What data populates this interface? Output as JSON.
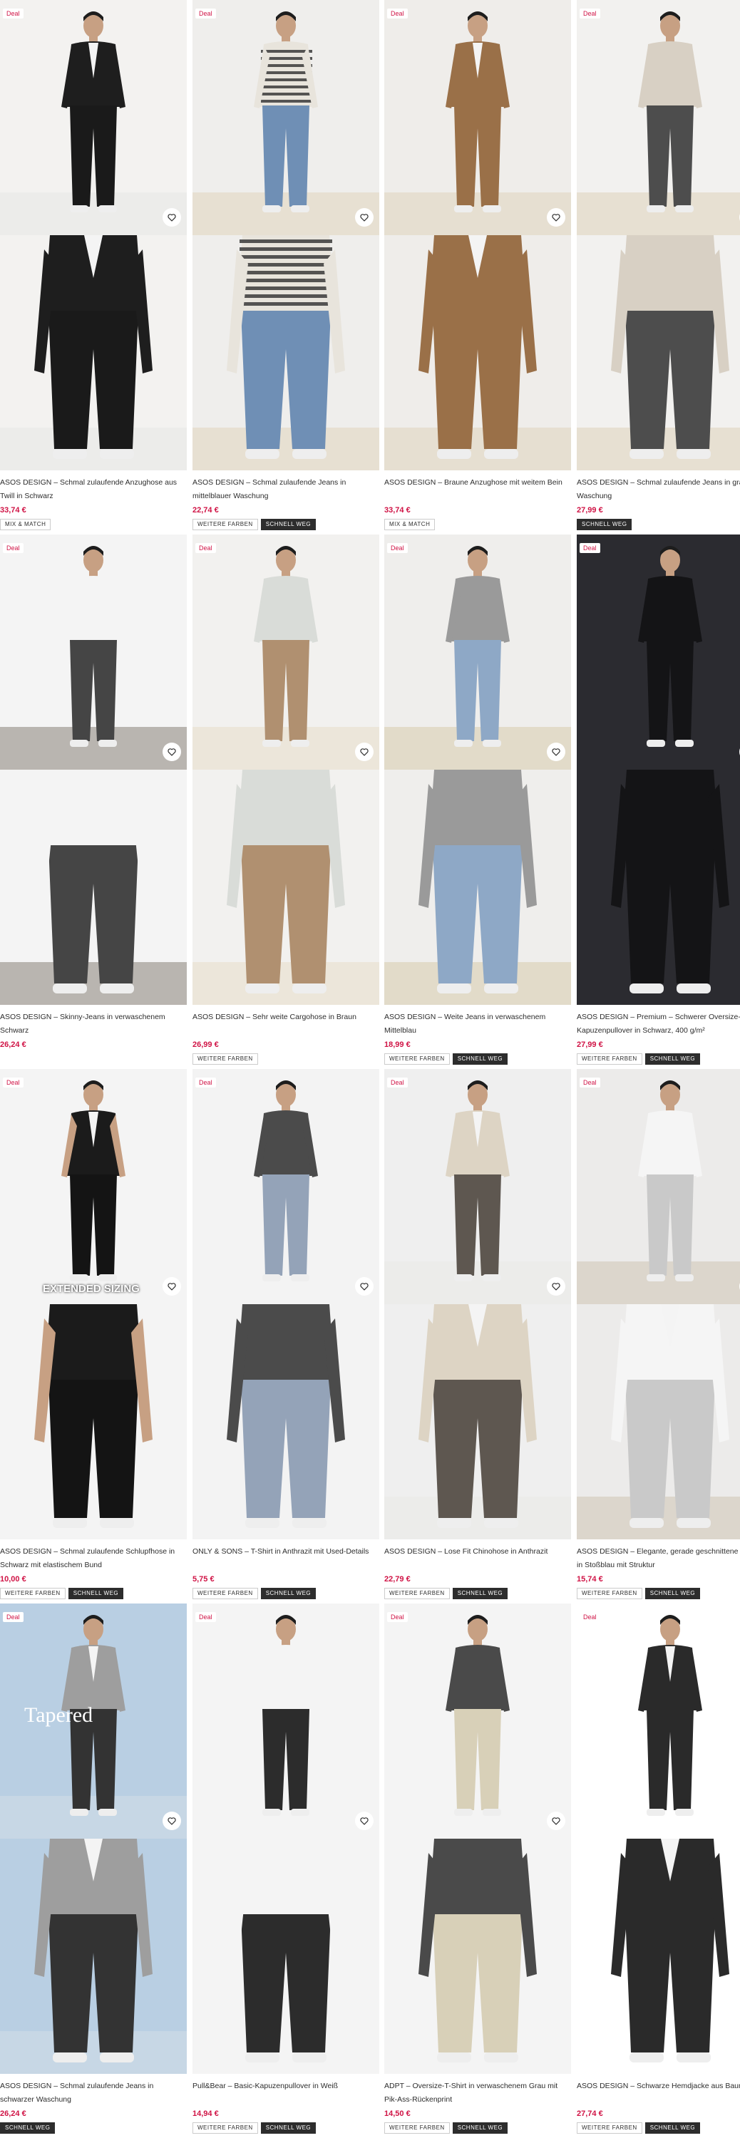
{
  "deal_label": "Deal",
  "products": [
    {
      "title": "ASOS DESIGN – Schmal zulaufende Anzughose aus Twill in Schwarz",
      "price": "33,74 €",
      "badges": [
        "MIX & MATCH"
      ],
      "deal": true
    },
    {
      "title": "ASOS DESIGN – Schmal zulaufende Jeans in mittelblauer Waschung",
      "price": "22,74 €",
      "badges": [
        "WEITERE FARBEN",
        "SCHNELL WEG"
      ],
      "deal": true
    },
    {
      "title": "ASOS DESIGN – Braune Anzughose mit weitem Bein",
      "price": "33,74 €",
      "badges": [
        "MIX & MATCH"
      ],
      "deal": true
    },
    {
      "title": "ASOS DESIGN – Schmal zulaufende Jeans in grauer Waschung",
      "price": "27,99 €",
      "badges": [
        "SCHNELL WEG"
      ],
      "deal": true
    },
    {
      "title": "ASOS DESIGN – Skinny-Jeans in verwaschenem Schwarz",
      "price": "26,24 €",
      "badges": [],
      "deal": true
    },
    {
      "title": "ASOS DESIGN – Sehr weite Cargohose in Braun",
      "price": "26,99 €",
      "badges": [
        "WEITERE FARBEN"
      ],
      "deal": true
    },
    {
      "title": "ASOS DESIGN – Weite Jeans in verwaschenem Mittelblau",
      "price": "18,99 €",
      "badges": [
        "WEITERE FARBEN",
        "SCHNELL WEG"
      ],
      "deal": true
    },
    {
      "title": "ASOS DESIGN – Premium – Schwerer Oversize-Kapuzenpullover in Schwarz, 400 g/m²",
      "price": "27,99 €",
      "badges": [
        "WEITERE FARBEN",
        "SCHNELL WEG"
      ],
      "deal": true
    },
    {
      "title": "ASOS DESIGN – Schmal zulaufende Schlupfhose in Schwarz mit elastischem Bund",
      "price": "10,00 €",
      "badges": [
        "WEITERE FARBEN",
        "SCHNELL WEG"
      ],
      "deal": true,
      "overlay": "EXTENDED SIZING"
    },
    {
      "title": "ONLY & SONS – T-Shirt in Anthrazit mit Used-Details",
      "price": "5,75 €",
      "badges": [
        "WEITERE FARBEN",
        "SCHNELL WEG"
      ],
      "deal": true
    },
    {
      "title": "ASOS DESIGN – Lose Fit Chinohose in Anthrazit",
      "price": "22,79 €",
      "badges": [
        "WEITERE FARBEN",
        "SCHNELL WEG"
      ],
      "deal": true
    },
    {
      "title": "ASOS DESIGN – Elegante, gerade geschnittene Hose in Stoßblau mit Struktur",
      "price": "15,74 €",
      "badges": [
        "WEITERE FARBEN",
        "SCHNELL WEG"
      ],
      "deal": true
    },
    {
      "title": "ASOS DESIGN – Schmal zulaufende Jeans in schwarzer Waschung",
      "price": "26,24 €",
      "badges": [
        "SCHNELL WEG"
      ],
      "deal": true,
      "overlay": "Tapered"
    },
    {
      "title": "Pull&Bear – Basic-Kapuzenpullover in Weiß",
      "price": "14,94 €",
      "badges": [
        "WEITERE FARBEN",
        "SCHNELL WEG"
      ],
      "deal": true
    },
    {
      "title": "ADPT – Oversize-T-Shirt in verwaschenem Grau mit Pik-Ass-Rückenprint",
      "price": "14,50 €",
      "badges": [
        "WEITERE FARBEN",
        "SCHNELL WEG"
      ],
      "deal": true
    },
    {
      "title": "ASOS DESIGN – Schwarze Hemdjacke aus Baumwolle",
      "price": "27,74 €",
      "badges": [
        "WEITERE FARBEN",
        "SCHNELL WEG"
      ],
      "deal": true
    }
  ],
  "icons": {
    "wishlist": "heart-icon"
  },
  "colors": {
    "price": "#d01345",
    "deal": "#d01345",
    "badge_dark": "#2d2d2d"
  }
}
